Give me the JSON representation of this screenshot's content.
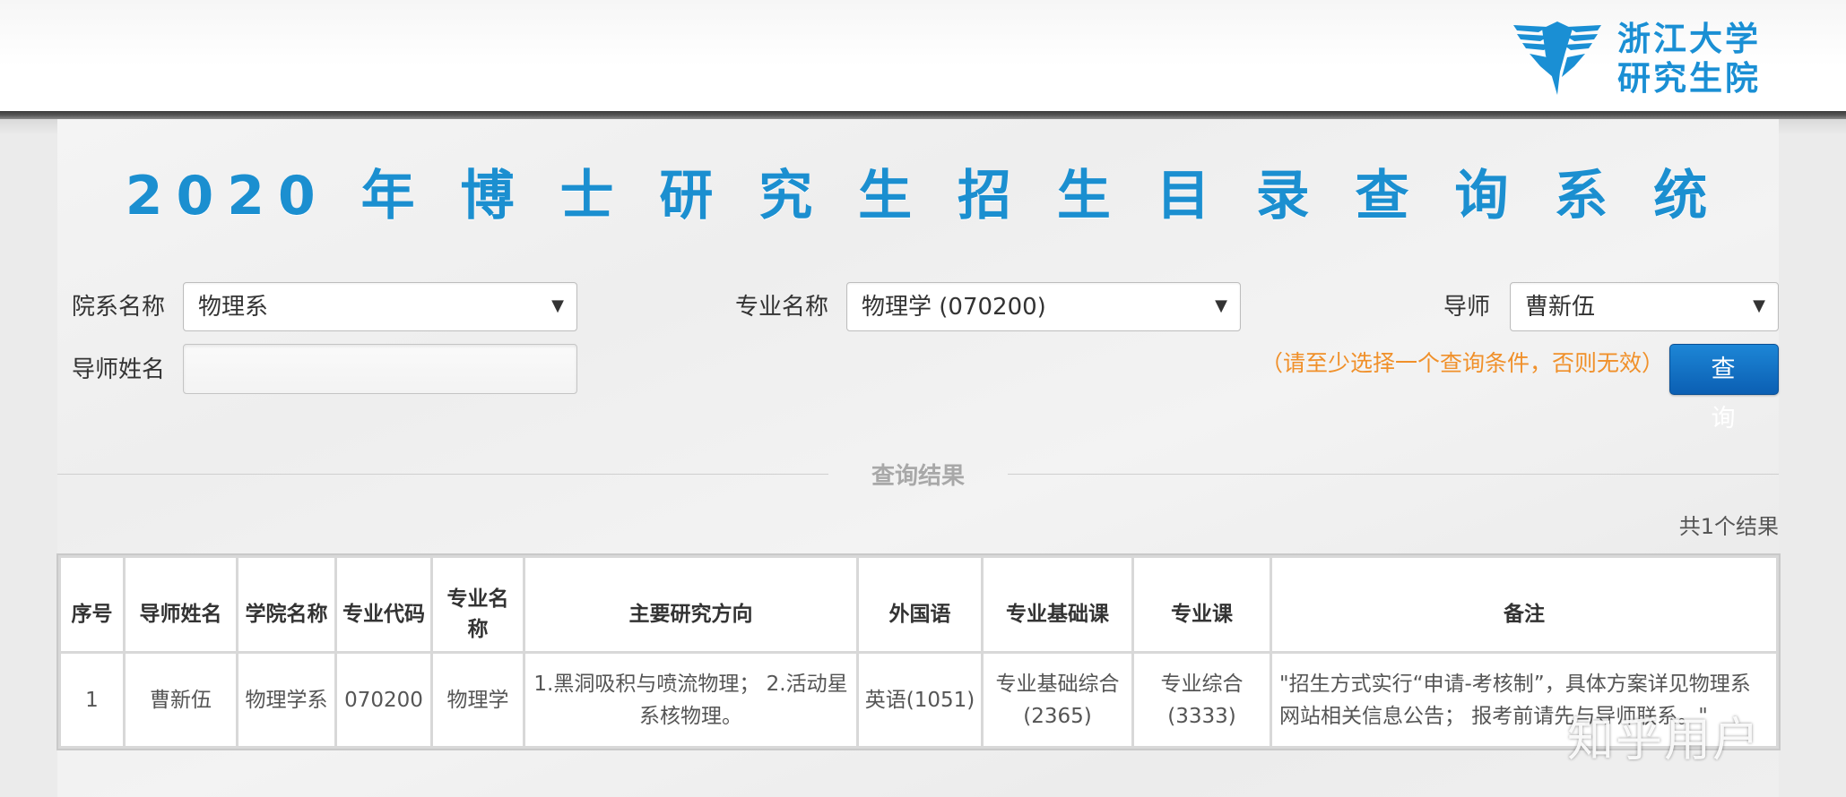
{
  "header": {
    "logo": {
      "line1": "浙江大学",
      "line2": "研究生院",
      "icon": "zju-eagle-logo-icon",
      "brand_color": "#1a8fd4"
    }
  },
  "page_title": "2020 年 博 士 研 究 生 招 生 目 录 查 询 系 统",
  "form": {
    "department_label": "院系名称",
    "department_value": "物理系",
    "major_label": "专业名称",
    "major_value": "物理学 (070200)",
    "advisor_label": "导师",
    "advisor_value": "曹新伍",
    "advisor_name_label": "导师姓名",
    "advisor_name_value": "",
    "hint": "（请至少选择一个查询条件，否则无效）",
    "search_button": "查 询",
    "caret": "▼"
  },
  "results": {
    "section_label": "查询结果",
    "count_text": "共1个结果",
    "columns": [
      "序号",
      "导师姓名",
      "学院名称",
      "专业代码",
      "专业名称",
      "主要研究方向",
      "外国语",
      "专业基础课",
      "专业课",
      "备注"
    ],
    "rows": [
      [
        "1",
        "曹新伍",
        "物理学系",
        "070200",
        "物理学",
        "1.黑洞吸积与喷流物理； 2.活动星系核物理。",
        "英语(1051)",
        "专业基础综合(2365)",
        "专业综合(3333)",
        "\"招生方式实行“申请-考核制”，具体方案详见物理系网站相关信息公告； 报考前请先与导师联系。\""
      ]
    ]
  },
  "watermark": "知乎用户",
  "colors": {
    "title": "#1b8fd0",
    "hint": "#f0902a",
    "button": "#0b5fb3"
  }
}
